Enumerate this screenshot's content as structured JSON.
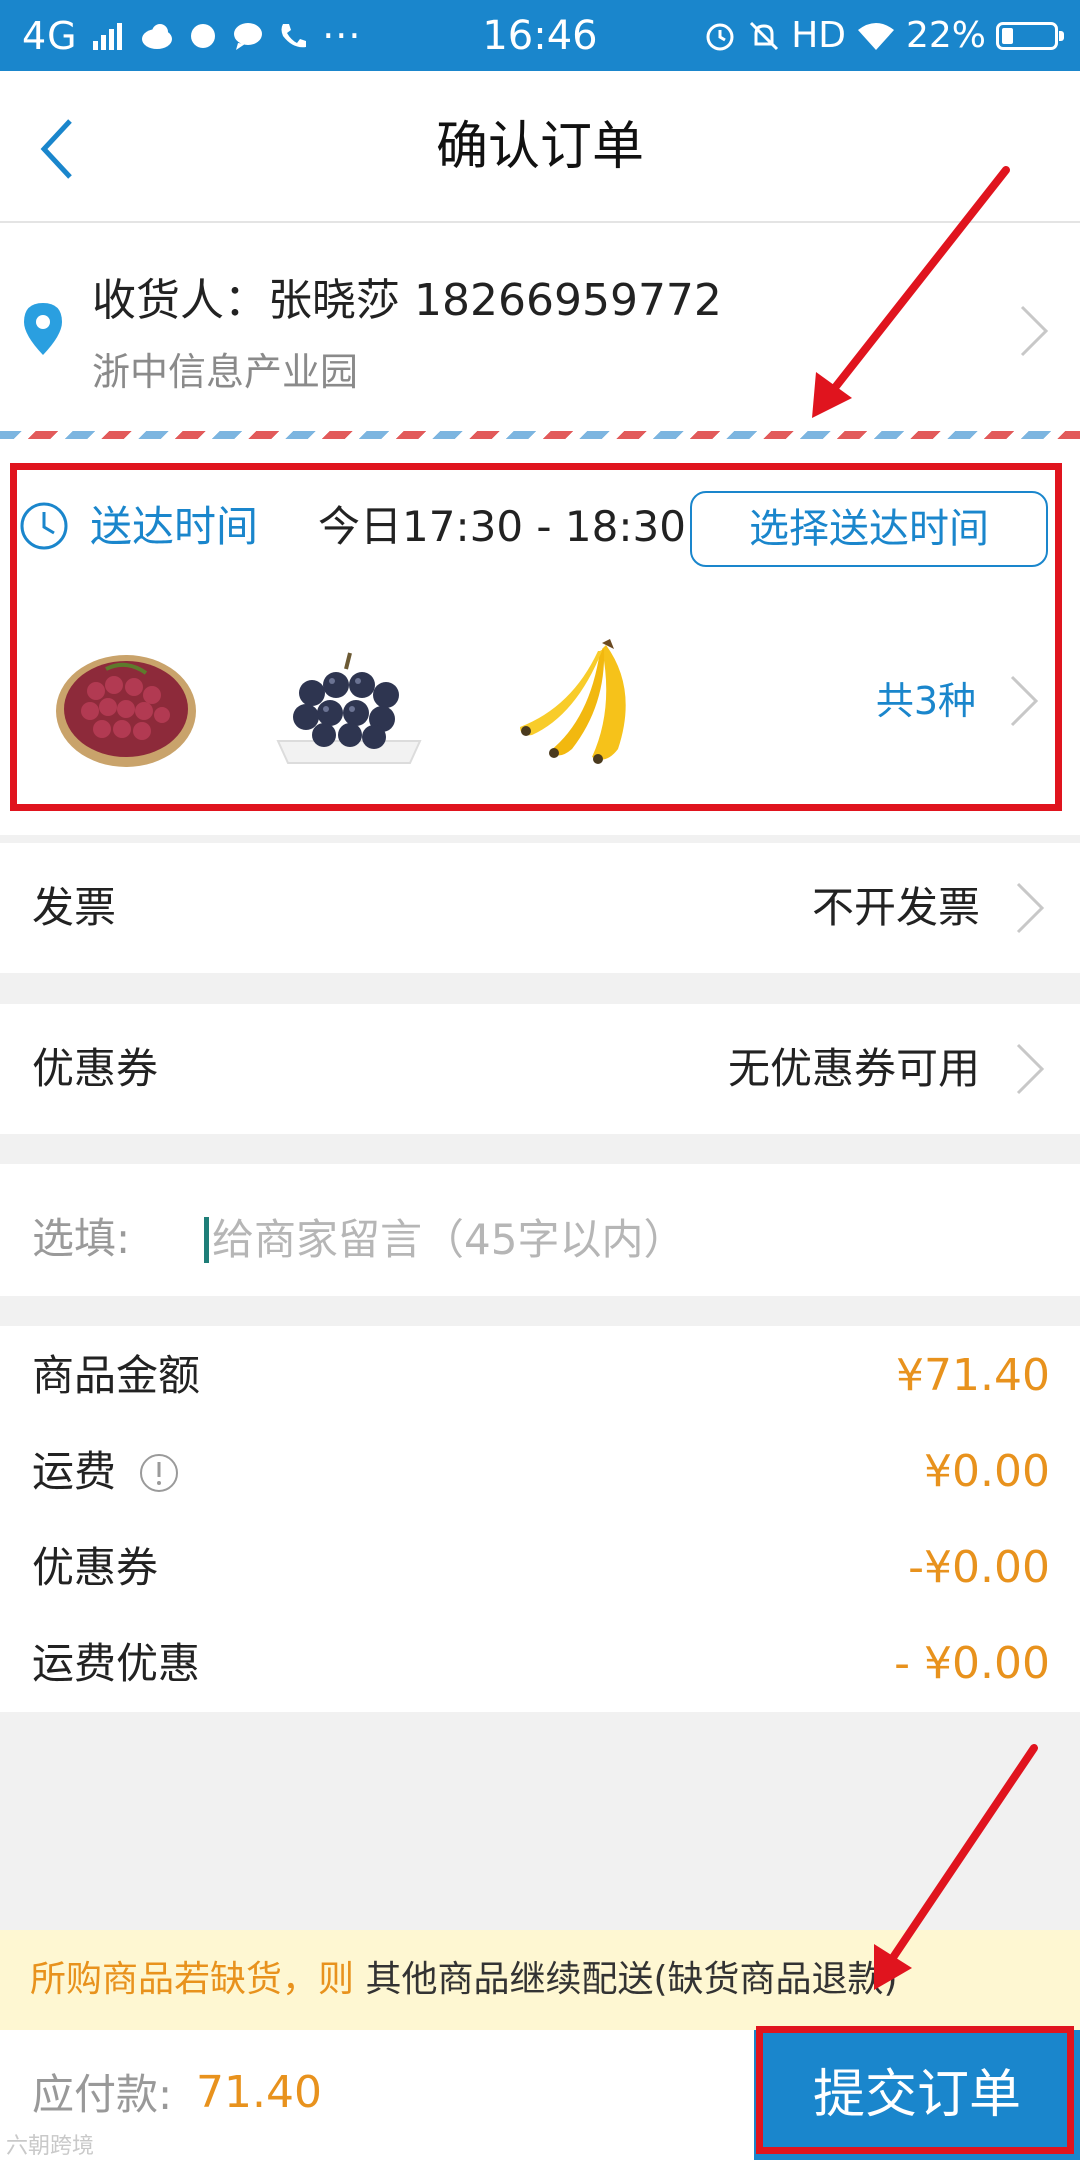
{
  "status_bar": {
    "network": "4G",
    "time": "16:46",
    "hd": "HD",
    "battery": "22%",
    "battery_level": 0.22
  },
  "header": {
    "title": "确认订单"
  },
  "address": {
    "recipient": "收货人：张晓莎   18266959772",
    "location": "浙中信息产业园"
  },
  "delivery": {
    "label": "送达时间",
    "time": "今日17:30 - 18:30",
    "select_button": "选择送达时间",
    "products": [
      {
        "icon": "red-grapes-image"
      },
      {
        "icon": "black-grapes-image"
      },
      {
        "icon": "bananas-image"
      }
    ],
    "count": "共3种"
  },
  "invoice": {
    "label": "发票",
    "value": "不开发票"
  },
  "coupon": {
    "label": "优惠券",
    "value": "无优惠券可用"
  },
  "remark": {
    "label": "选填:",
    "placeholder": "给商家留言（45字以内）"
  },
  "summary": {
    "items": [
      {
        "label": "商品金额",
        "value": "¥71.40"
      },
      {
        "label": "运费",
        "value": "¥0.00"
      },
      {
        "label": "优惠券",
        "value": "-¥0.00"
      },
      {
        "label": "运费优惠",
        "value": "- ¥0.00"
      }
    ]
  },
  "notice": {
    "highlight": "所购商品若缺货，则",
    "text": " 其他商品继续配送(缺货商品退款)"
  },
  "footer": {
    "payable_label": "应付款:",
    "payable_amount": "71.40",
    "submit": "提交订单"
  },
  "colors": {
    "primary": "#1a86cc",
    "price": "#e8921d",
    "highlight_border": "#e0141e",
    "notice_bg": "#fef7d2"
  },
  "watermark": "六朝跨境"
}
